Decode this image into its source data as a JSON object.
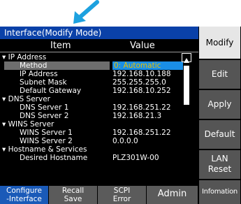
{
  "title": "Interface(Modify Mode)",
  "columns": {
    "item": "Item",
    "value": "Value"
  },
  "rows": [
    {
      "type": "group",
      "label": "IP Address"
    },
    {
      "type": "item",
      "label": "Method",
      "value": "0: Automatic",
      "selected": true
    },
    {
      "type": "item",
      "label": "IP Address",
      "value": "192.168.10.188"
    },
    {
      "type": "item",
      "label": "Subnet Mask",
      "value": "255.255.255.0"
    },
    {
      "type": "item",
      "label": "Default Gateway",
      "value": "192.168.10.252"
    },
    {
      "type": "group",
      "label": "DNS Server"
    },
    {
      "type": "item",
      "label": "DNS Server 1",
      "value": "192.168.251.22"
    },
    {
      "type": "item",
      "label": "DNS Server 2",
      "value": "192.168.21.3"
    },
    {
      "type": "group",
      "label": "WINS Server"
    },
    {
      "type": "item",
      "label": "WINS Server 1",
      "value": "192.168.251.22"
    },
    {
      "type": "item",
      "label": "WINS Server 2",
      "value": "0.0.0.0"
    },
    {
      "type": "group",
      "label": "Hostname & Services"
    },
    {
      "type": "item",
      "label": "Desired Hostname",
      "value": "PLZ301W-00"
    }
  ],
  "softkeys": [
    {
      "line1": "Configure",
      "line2": "-Interface",
      "active": true
    },
    {
      "line1": "Recall",
      "line2": "Save",
      "active": false
    },
    {
      "line1": "SCPI",
      "line2": "Error",
      "active": false
    },
    {
      "line1": "Admin",
      "line2": "",
      "active": false
    }
  ],
  "side_buttons": [
    {
      "line1": "Modify",
      "line2": ""
    },
    {
      "line1": "Edit",
      "line2": ""
    },
    {
      "line1": "Apply",
      "line2": ""
    },
    {
      "line1": "Default",
      "line2": ""
    },
    {
      "line1": "LAN",
      "line2": "Reset"
    },
    {
      "line1": "Infomation",
      "line2": ""
    }
  ],
  "colors": {
    "title_bg": "#0a41a8",
    "selected_value_bg": "#1a8ee6",
    "selected_value_text": "#e8c100",
    "arrow": "#1da1df"
  }
}
